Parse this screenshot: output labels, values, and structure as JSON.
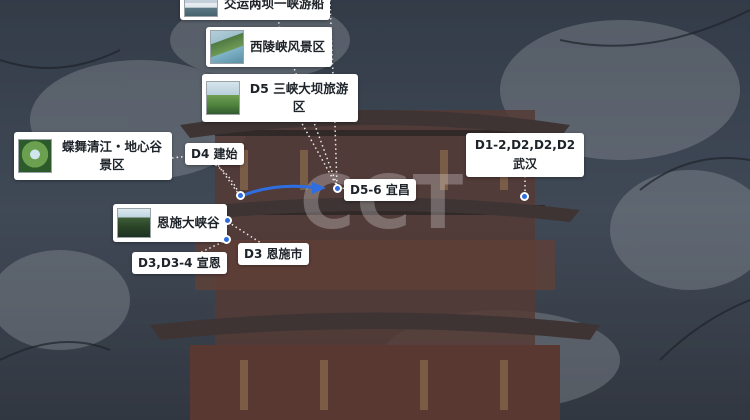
{
  "watermark": "CCT",
  "colors": {
    "route": "#2f6ee0",
    "marker": "#2f6ee0",
    "connector": "#ffffff",
    "card_bg": "#ffffff",
    "text": "#1d2329"
  },
  "attractions": [
    {
      "id": "boat",
      "name": "交运两坝一峡游船",
      "thumb": "boat"
    },
    {
      "id": "xiling",
      "name": "西陵峡风景区",
      "thumb": "gorge"
    },
    {
      "id": "sanxia",
      "name": "D5 三峡大坝旅游区",
      "thumb": "dam"
    },
    {
      "id": "dixin",
      "name": "蝶舞清江・地心谷景区",
      "thumb": "cave"
    },
    {
      "id": "enshi",
      "name": "恩施大峡谷",
      "thumb": "canyon"
    }
  ],
  "cities": [
    {
      "id": "jianshi",
      "label": "D4 建始"
    },
    {
      "id": "yichang",
      "label": "D5-6 宜昌"
    },
    {
      "id": "wuhan",
      "label": "D1-2,D2,D2,D2 武汉"
    },
    {
      "id": "enshi_city",
      "label": "D3 恩施市"
    },
    {
      "id": "xuanen",
      "label": "D3,D3-4 宣恩"
    }
  ]
}
